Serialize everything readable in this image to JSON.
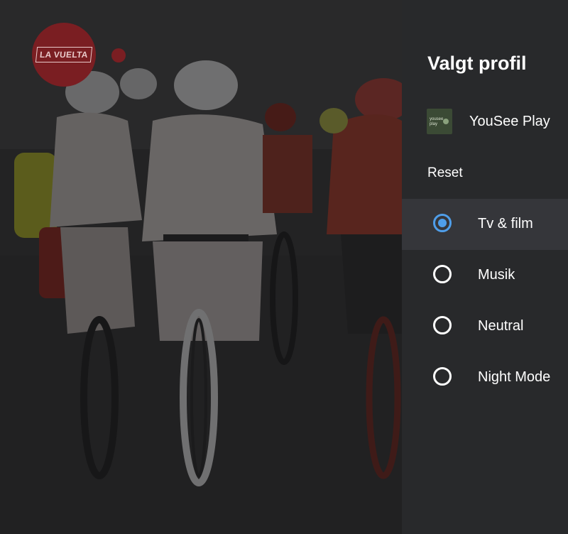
{
  "video": {
    "logo_text": "LA VUELTA",
    "logo_icon": "la-vuelta-logo",
    "live_indicator_icon": "record-dot-icon"
  },
  "panel": {
    "title": "Valgt profil",
    "profile": {
      "name": "YouSee Play",
      "thumb_line1": "yousee",
      "thumb_line2": "play",
      "thumb_icon": "yousee-play-logo"
    },
    "reset_label": "Reset",
    "options": [
      {
        "label": "Tv & film",
        "selected": true
      },
      {
        "label": "Musik",
        "selected": false
      },
      {
        "label": "Neutral",
        "selected": false
      },
      {
        "label": "Night Mode",
        "selected": false
      }
    ],
    "accent_color": "#4f9ee9",
    "background_color": "#28292b"
  }
}
